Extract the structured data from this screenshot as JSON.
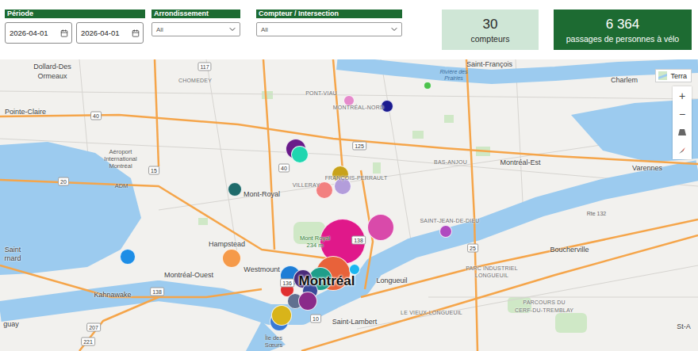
{
  "filters": [
    {
      "label": "Période",
      "kind": "dates",
      "values": [
        "2026-04-01",
        "2026-04-01"
      ]
    },
    {
      "label": "Arrondissement",
      "kind": "dropdown",
      "values": [
        "All"
      ]
    },
    {
      "label": "Compteur / Intersection",
      "kind": "dropdown",
      "values": [
        "All"
      ]
    }
  ],
  "cards": [
    {
      "value": "30",
      "caption": "compteurs",
      "kind": "light"
    },
    {
      "value": "6 364",
      "caption": "passages de personnes à vélo",
      "kind": "dark"
    }
  ],
  "map": {
    "style_button": "Terra",
    "controls": [
      "+",
      "−"
    ],
    "counters": [
      {
        "color": "#4cc24c",
        "level": 0.17
      },
      {
        "color": "#e58acb",
        "level": 0.24
      },
      {
        "color": "#1b1b8f",
        "level": 0.28
      },
      {
        "color": "#6a1b8a",
        "level": 0.45
      },
      {
        "color": "#1fd6b0",
        "level": 0.38
      },
      {
        "color": "#c8a21a",
        "level": 0.38
      },
      {
        "color": "#b39ddb",
        "level": 0.38
      },
      {
        "color": "#f28080",
        "level": 0.38
      },
      {
        "color": "#1f6b6b",
        "level": 0.31
      },
      {
        "color": "#e0188a",
        "level": 1
      },
      {
        "color": "#d94aaa",
        "level": 0.59
      },
      {
        "color": "#b04ac0",
        "level": 0.28
      },
      {
        "color": "#1e8ee6",
        "level": 0.34
      },
      {
        "color": "#f59a4a",
        "level": 0.41
      },
      {
        "color": "#1e7ed6",
        "level": 0.45
      },
      {
        "color": "#e8623a",
        "level": 0.76
      },
      {
        "color": "#1f9e8a",
        "level": 0.52
      },
      {
        "color": "#1ab6f0",
        "level": 0.24
      },
      {
        "color": "#4a2a7a",
        "level": 0.41
      },
      {
        "color": "#e03030",
        "level": 0.31
      },
      {
        "color": "#3a4a9a",
        "level": 0.34
      },
      {
        "color": "#607090",
        "level": 0.34
      },
      {
        "color": "#8a2a8a",
        "level": 0.41
      },
      {
        "color": "#3a7ad6",
        "level": 0.41
      },
      {
        "color": "#d8b41a",
        "level": 0.45
      }
    ],
    "labels": [
      {
        "text": "Saint-François",
        "kind": "place"
      },
      {
        "text": "Rivière des",
        "kind": "water"
      },
      {
        "text": "Prairies",
        "kind": "water"
      },
      {
        "text": "Charlem",
        "kind": "place"
      },
      {
        "text": "Dollard-Des",
        "kind": "place"
      },
      {
        "text": "Ormeaux",
        "kind": "place"
      },
      {
        "text": "CHOMEDEY",
        "kind": "district"
      },
      {
        "text": "PONT-VIAU",
        "kind": "district"
      },
      {
        "text": "MONTRÉAL-NORD",
        "kind": "district"
      },
      {
        "text": "Pointe-Claire",
        "kind": "place"
      },
      {
        "text": "Aéroport",
        "kind": "poi"
      },
      {
        "text": "International",
        "kind": "poi"
      },
      {
        "text": "Montréal",
        "kind": "poi"
      },
      {
        "text": "ADM",
        "kind": "poi"
      },
      {
        "text": "Mont-Royal",
        "kind": "place"
      },
      {
        "text": "VILLERAY",
        "kind": "district"
      },
      {
        "text": "FRANÇOIS-PERRAULT",
        "kind": "district"
      },
      {
        "text": "BAS-ANJOU",
        "kind": "district"
      },
      {
        "text": "Montréal-Est",
        "kind": "place"
      },
      {
        "text": "Varennes",
        "kind": "place"
      },
      {
        "text": "SAINT-JEAN-DE-DIEU",
        "kind": "district"
      },
      {
        "text": "Mont Royal",
        "kind": "park"
      },
      {
        "text": "234 m",
        "kind": "park"
      },
      {
        "text": "Hampstead",
        "kind": "place"
      },
      {
        "text": "Boucherville",
        "kind": "place"
      },
      {
        "text": "Westmount",
        "kind": "place"
      },
      {
        "text": "Montréal",
        "kind": "city"
      },
      {
        "text": "PARC INDUSTRIEL",
        "kind": "district"
      },
      {
        "text": "LONGUEUIL",
        "kind": "district"
      },
      {
        "text": "Longueuil",
        "kind": "place"
      },
      {
        "text": "Montréal-Ouest",
        "kind": "place"
      },
      {
        "text": "Kahnawake",
        "kind": "place"
      },
      {
        "text": "LE VIEUX-LONGUEUIL",
        "kind": "district"
      },
      {
        "text": "PARCOURS DU",
        "kind": "district"
      },
      {
        "text": "CERF-DU-TREMBLAY",
        "kind": "district"
      },
      {
        "text": "Saint-Lambert",
        "kind": "place"
      },
      {
        "text": "Île des",
        "kind": "poi"
      },
      {
        "text": "Sœurs",
        "kind": "poi"
      },
      {
        "text": "Saint",
        "kind": "place"
      },
      {
        "text": "rnard",
        "kind": "place"
      },
      {
        "text": "guay",
        "kind": "place"
      },
      {
        "text": "St-A",
        "kind": "place"
      },
      {
        "text": "Rte 132",
        "kind": "roadname"
      },
      {
        "text": "117",
        "kind": "road"
      },
      {
        "text": "40",
        "kind": "road"
      },
      {
        "text": "15",
        "kind": "road"
      },
      {
        "text": "40",
        "kind": "road"
      },
      {
        "text": "125",
        "kind": "road"
      },
      {
        "text": "20",
        "kind": "road"
      },
      {
        "text": "138",
        "kind": "road"
      },
      {
        "text": "25",
        "kind": "road"
      },
      {
        "text": "138",
        "kind": "road"
      },
      {
        "text": "136",
        "kind": "road"
      },
      {
        "text": "10",
        "kind": "road"
      },
      {
        "text": "207",
        "kind": "road"
      },
      {
        "text": "221",
        "kind": "road"
      }
    ]
  }
}
